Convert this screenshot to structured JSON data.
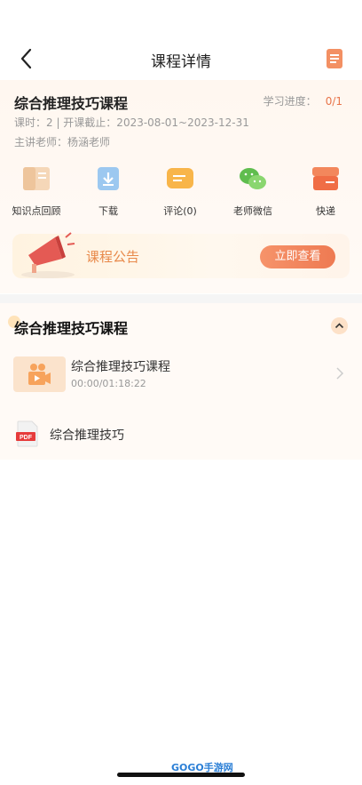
{
  "nav": {
    "title": "课程详情"
  },
  "course": {
    "title": "综合推理技巧课程",
    "progress_label": "学习进度：",
    "progress_value": "0/1",
    "hours_line": "课时：2 | 开课截止：2023-08-01~2023-12-31",
    "teacher_line": "主讲老师：杨涵老师"
  },
  "tools": [
    {
      "label": "知识点回顾",
      "icon": "book-icon"
    },
    {
      "label": "下载",
      "icon": "download-icon"
    },
    {
      "label": "评论(0)",
      "icon": "comment-icon"
    },
    {
      "label": "老师微信",
      "icon": "wechat-icon"
    },
    {
      "label": "快递",
      "icon": "express-box-icon"
    }
  ],
  "notice": {
    "label": "课程公告",
    "button": "立即查看",
    "icon": "megaphone-icon"
  },
  "section": {
    "title": "综合推理技巧课程",
    "video": {
      "title": "综合推理技巧课程",
      "time": "00:00/01:18:22"
    },
    "pdf": {
      "name": "综合推理技巧",
      "badge": "PDF"
    }
  },
  "watermark": {
    "text": "GOGO手游网"
  },
  "colors": {
    "accent": "#ee7a52",
    "notice_text": "#e8894a",
    "progress": "#e8744a"
  }
}
